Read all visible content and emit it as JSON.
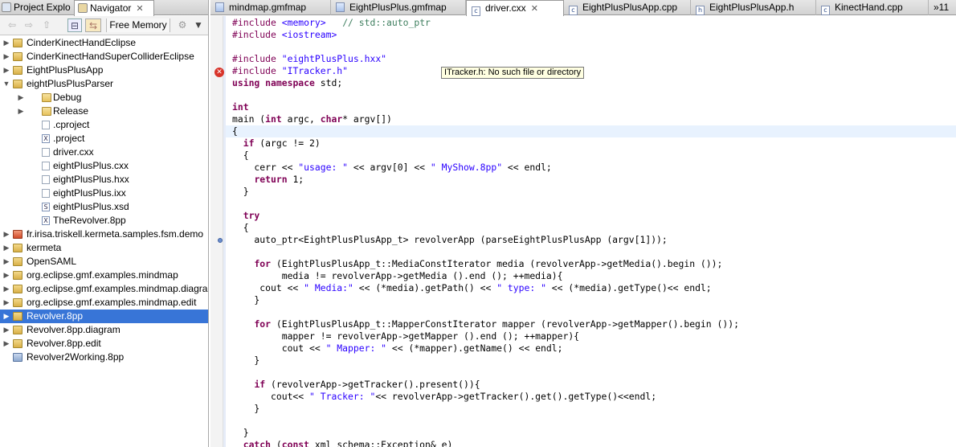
{
  "left_panel": {
    "tabs": [
      {
        "label": "Project Explo",
        "active": false
      },
      {
        "label": "Navigator",
        "active": true,
        "close": "✕"
      }
    ],
    "toolbar": {
      "back": "⇦",
      "forward": "⇨",
      "up": "⇧",
      "collapse": "⊟",
      "link": "⇆",
      "memory_label": "Free Memory",
      "gc": "⚙",
      "menu": "▼"
    },
    "tree": [
      {
        "label": "CinderKinectHandEclipse",
        "type": "project",
        "expanded": false,
        "depth": 0
      },
      {
        "label": "CinderKinectHandSuperColliderEclipse",
        "type": "project",
        "expanded": false,
        "depth": 0
      },
      {
        "label": "EightPlusPlusApp",
        "type": "project",
        "expanded": false,
        "depth": 0
      },
      {
        "label": "eightPlusPlusParser",
        "type": "project",
        "expanded": true,
        "depth": 0
      },
      {
        "label": "Debug",
        "type": "folder",
        "expanded": false,
        "depth": 1
      },
      {
        "label": "Release",
        "type": "folder",
        "expanded": false,
        "depth": 1
      },
      {
        "label": ".cproject",
        "type": "file",
        "depth": 1
      },
      {
        "label": ".project",
        "type": "xml",
        "depth": 1
      },
      {
        "label": "driver.cxx",
        "type": "file",
        "depth": 1
      },
      {
        "label": "eightPlusPlus.cxx",
        "type": "file",
        "depth": 1
      },
      {
        "label": "eightPlusPlus.hxx",
        "type": "file",
        "depth": 1
      },
      {
        "label": "eightPlusPlus.ixx",
        "type": "file",
        "depth": 1
      },
      {
        "label": "eightPlusPlus.xsd",
        "type": "xsd",
        "depth": 1
      },
      {
        "label": "TheRevolver.8pp",
        "type": "xml",
        "depth": 1
      },
      {
        "label": "fr.irisa.triskell.kermeta.samples.fsm.demo",
        "type": "project-red",
        "expanded": false,
        "depth": 0
      },
      {
        "label": "kermeta",
        "type": "project",
        "expanded": false,
        "depth": 0
      },
      {
        "label": "OpenSAML",
        "type": "project",
        "expanded": false,
        "depth": 0
      },
      {
        "label": "org.eclipse.gmf.examples.mindmap",
        "type": "project",
        "expanded": false,
        "depth": 0
      },
      {
        "label": "org.eclipse.gmf.examples.mindmap.diagram",
        "type": "project",
        "expanded": false,
        "depth": 0
      },
      {
        "label": "org.eclipse.gmf.examples.mindmap.edit",
        "type": "project",
        "expanded": false,
        "depth": 0
      },
      {
        "label": "Revolver.8pp",
        "type": "project",
        "expanded": false,
        "depth": 0,
        "selected": true
      },
      {
        "label": "Revolver.8pp.diagram",
        "type": "project",
        "expanded": false,
        "depth": 0
      },
      {
        "label": "Revolver.8pp.edit",
        "type": "project",
        "expanded": false,
        "depth": 0
      },
      {
        "label": "Revolver2Working.8pp",
        "type": "project-blue",
        "depth": 0
      }
    ]
  },
  "editor": {
    "tabs": [
      {
        "label": "mindmap.gmfmap",
        "icon": "map"
      },
      {
        "label": "EightPlusPlus.gmfmap",
        "icon": "map"
      },
      {
        "label": "driver.cxx",
        "icon": "c",
        "active": true,
        "close": "✕"
      },
      {
        "label": "EightPlusPlusApp.cpp",
        "icon": "c"
      },
      {
        "label": "EightPlusPlusApp.h",
        "icon": "h"
      },
      {
        "label": "KinectHand.cpp",
        "icon": "c"
      }
    ],
    "overflow_tab": "»11",
    "tooltip": "ITracker.h: No such file or directory",
    "error_marker": "✕",
    "code_lines": [
      "#include <memory>   // std::auto_ptr",
      "#include <iostream>",
      "",
      "#include \"eightPlusPlus.hxx\"",
      "#include \"ITracker.h\"",
      "using namespace std;",
      "",
      "int",
      "main (int argc, char* argv[])",
      "{",
      "  if (argc != 2)",
      "  {",
      "    cerr << \"usage: \" << argv[0] << \" MyShow.8pp\" << endl;",
      "    return 1;",
      "  }",
      "",
      "  try",
      "  {",
      "    auto_ptr<EightPlusPlusApp_t> revolverApp (parseEightPlusPlusApp (argv[1]));",
      "",
      "    for (EightPlusPlusApp_t::MediaConstIterator media (revolverApp->getMedia().begin ());",
      "         media != revolverApp->getMedia ().end (); ++media){",
      "     cout << \" Media:\" << (*media).getPath() << \" type: \" << (*media).getType()<< endl;",
      "    }",
      "",
      "    for (EightPlusPlusApp_t::MapperConstIterator mapper (revolverApp->getMapper().begin ());",
      "         mapper != revolverApp->getMapper ().end (); ++mapper){",
      "         cout << \" Mapper: \" << (*mapper).getName() << endl;",
      "    }",
      "",
      "    if (revolverApp->getTracker().present()){",
      "       cout<< \" Tracker: \"<< revolverApp->getTracker().get().getType()<<endl;",
      "    }",
      "",
      "  }",
      "  catch (const xml_schema::Exception& e)"
    ]
  }
}
